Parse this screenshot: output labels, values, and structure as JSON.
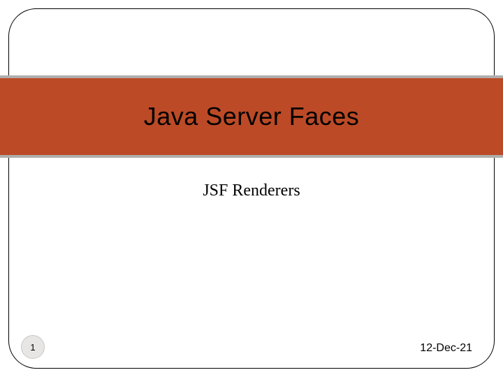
{
  "slide": {
    "title": "Java Server Faces",
    "subtitle": "JSF Renderers",
    "page_number": "1",
    "date": "12-Dec-21"
  }
}
